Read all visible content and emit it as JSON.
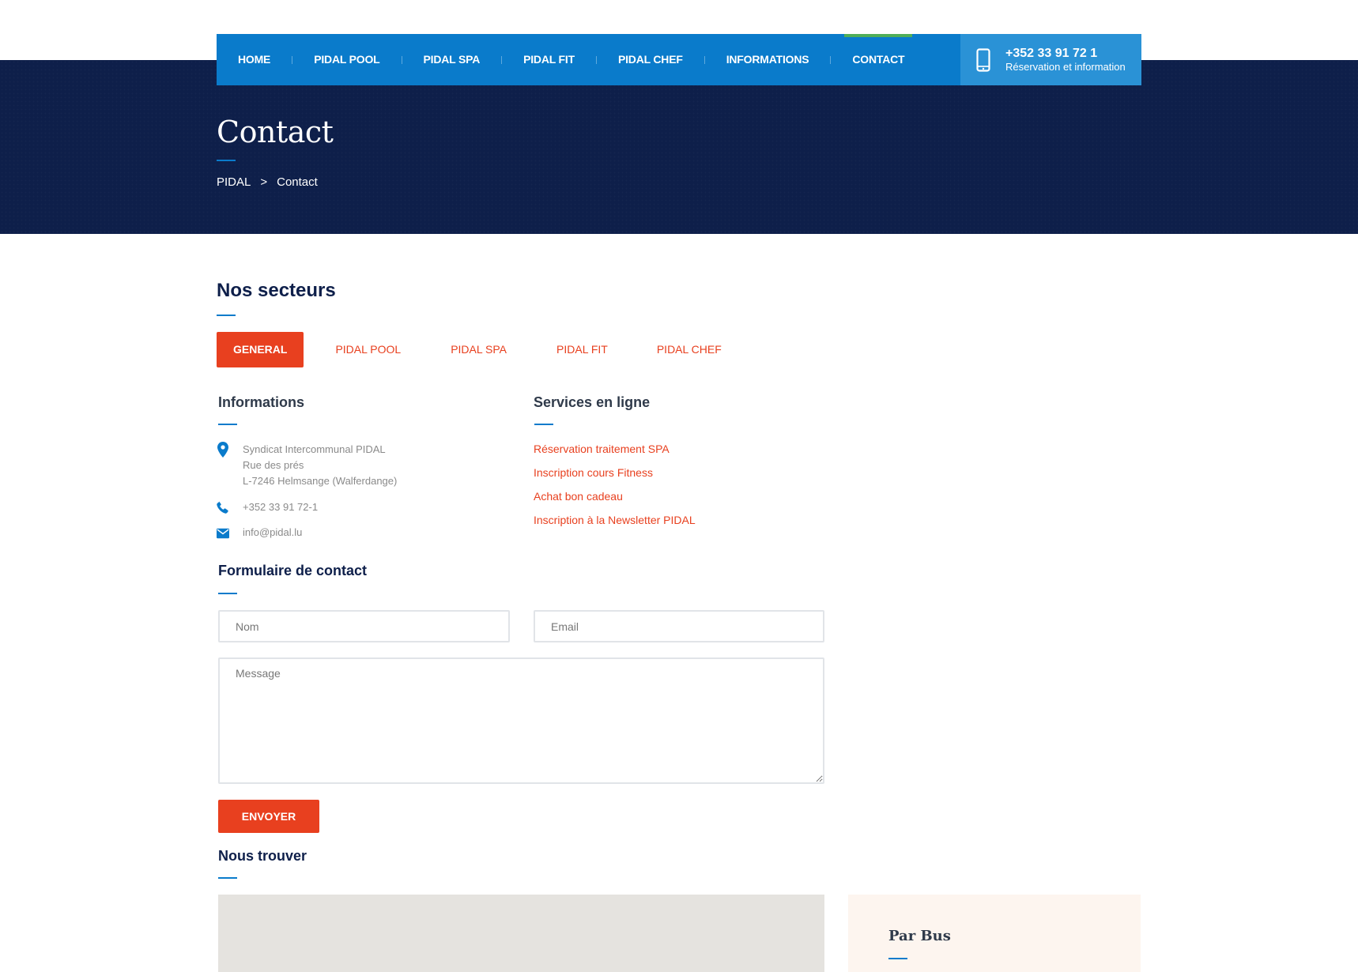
{
  "nav": {
    "items": [
      {
        "label": "HOME"
      },
      {
        "label": "PIDAL POOL"
      },
      {
        "label": "PIDAL SPA"
      },
      {
        "label": "PIDAL FIT"
      },
      {
        "label": "PIDAL CHEF"
      },
      {
        "label": "INFORMATIONS"
      },
      {
        "label": "CONTACT",
        "active": true
      }
    ],
    "phone": {
      "icon": "mobile-phone-icon",
      "number": "+352 33 91 72 1",
      "subtitle": "Réservation et information"
    }
  },
  "hero": {
    "title": "Contact",
    "breadcrumb": [
      "PIDAL",
      ">",
      "Contact"
    ]
  },
  "sectors": {
    "title": "Nos secteurs",
    "tabs": [
      {
        "label": "GENERAL",
        "active": true
      },
      {
        "label": "PIDAL POOL"
      },
      {
        "label": "PIDAL SPA"
      },
      {
        "label": "PIDAL FIT"
      },
      {
        "label": "PIDAL CHEF"
      }
    ]
  },
  "informations": {
    "title": "Informations",
    "address": [
      "Syndicat Intercommunal PIDAL",
      "Rue des prés",
      "L-7246 Helmsange (Walferdange)"
    ],
    "phone": "+352 33 91 72-1",
    "email": "info@pidal.lu"
  },
  "services": {
    "title": "Services en ligne",
    "links": [
      "Réservation traitement SPA",
      "Inscription cours Fitness",
      "Achat bon cadeau",
      "Inscription à la Newsletter PIDAL"
    ]
  },
  "contact_form": {
    "title": "Formulaire de contact",
    "name_placeholder": "Nom",
    "email_placeholder": "Email",
    "message_placeholder": "Message",
    "submit_label": "ENVOYER"
  },
  "find_us": {
    "title": "Nous trouver",
    "bus_title": "Par Bus"
  },
  "colors": {
    "nav_blue": "#0a7bcb",
    "hero_navy": "#0e1f4a",
    "accent_red": "#e8401f",
    "active_marker_green": "#4fae58"
  }
}
